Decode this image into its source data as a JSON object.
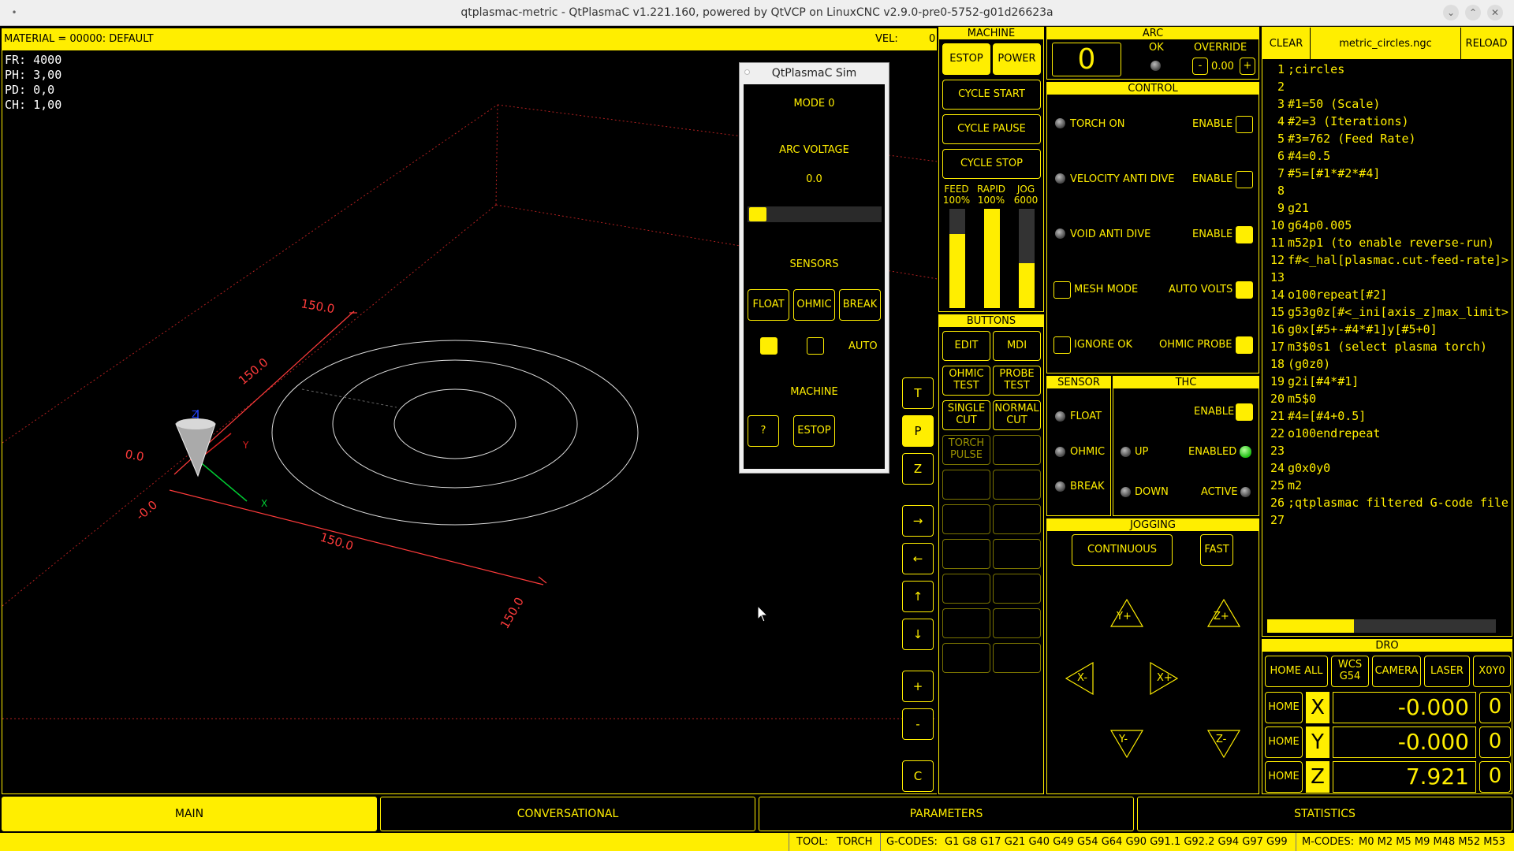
{
  "window": {
    "title": "qtplasmac-metric - QtPlasmaC v1.221.160, powered by QtVCP on LinuxCNC v2.9.0-pre0-5752-g01d26623a"
  },
  "preview": {
    "material": "MATERIAL = 00000: DEFAULT",
    "vel_label": "VEL:",
    "vel_value": "0",
    "stats": [
      "FR: 4000",
      "PH: 3,00",
      "PD: 0,0",
      "CH: 1,00"
    ],
    "dims": {
      "a": "150.0",
      "b": "150.0",
      "c": "0.0",
      "d": "-0.0",
      "e": "150.0",
      "f": "150.0"
    },
    "axis_labels": {
      "x": "X",
      "y": "Y",
      "z": "Z"
    }
  },
  "side_buttons": [
    "T",
    "P",
    "Z",
    "→",
    "←",
    "↑",
    "↓",
    "+",
    "-",
    "C"
  ],
  "sim": {
    "title": "QtPlasmaC Sim",
    "mode": "MODE 0",
    "arc_voltage_label": "ARC VOLTAGE",
    "arc_voltage_value": "0.0",
    "sensors_label": "SENSORS",
    "float": "FLOAT",
    "ohmic": "OHMIC",
    "break": "BREAK",
    "auto": "AUTO",
    "machine_label": "MACHINE",
    "help": "?",
    "estop": "ESTOP"
  },
  "machine": {
    "header": "MACHINE",
    "estop": "ESTOP",
    "power": "POWER",
    "cycle_start": "CYCLE START",
    "cycle_pause": "CYCLE PAUSE",
    "cycle_stop": "CYCLE STOP",
    "feed_label": "FEED",
    "feed_value": "100%",
    "rapid_label": "RAPID",
    "rapid_value": "100%",
    "jog_label": "JOG",
    "jog_value": "6000",
    "feed_level": 0.75,
    "rapid_level": 1.0,
    "jog_level": 0.45
  },
  "buttons": {
    "header": "BUTTONS",
    "edit": "EDIT",
    "mdi": "MDI",
    "ohmic_test": "OHMIC\nTEST",
    "probe_test": "PROBE\nTEST",
    "single_cut": "SINGLE\nCUT",
    "normal_cut": "NORMAL\nCUT",
    "torch_pulse": "TORCH\nPULSE"
  },
  "arc": {
    "header": "ARC",
    "value": "0",
    "ok": "OK",
    "override": "OVERRIDE",
    "minus": "-",
    "override_value": "0.00",
    "plus": "+"
  },
  "control": {
    "header": "CONTROL",
    "torch_on": "TORCH ON",
    "velocity_anti_dive": "VELOCITY ANTI DIVE",
    "void_anti_dive": "VOID ANTI DIVE",
    "enable": "ENABLE",
    "mesh_mode": "MESH MODE",
    "auto_volts": "AUTO VOLTS",
    "ignore_ok": "IGNORE OK",
    "ohmic_probe": "OHMIC PROBE"
  },
  "sensor": {
    "header": "SENSOR",
    "float": "FLOAT",
    "ohmic": "OHMIC",
    "break": "BREAK"
  },
  "thc": {
    "header": "THC",
    "enable": "ENABLE",
    "up": "UP",
    "enabled": "ENABLED",
    "down": "DOWN",
    "active": "ACTIVE"
  },
  "jogging": {
    "header": "JOGGING",
    "continuous": "CONTINUOUS",
    "fast": "FAST",
    "y_plus": "Y+",
    "z_plus": "Z+",
    "x_minus": "X-",
    "x_plus": "X+",
    "y_minus": "Y-",
    "z_minus": "Z-"
  },
  "gcode": {
    "clear": "CLEAR",
    "filename": "metric_circles.ngc",
    "reload": "RELOAD",
    "lines": [
      {
        "n": "1",
        "text": ";circles"
      },
      {
        "n": "2",
        "text": ""
      },
      {
        "n": "3",
        "text": "#1=50 (Scale)"
      },
      {
        "n": "4",
        "text": "#2=3 (Iterations)"
      },
      {
        "n": "5",
        "text": "#3=762 (Feed Rate)"
      },
      {
        "n": "6",
        "text": "#4=0.5"
      },
      {
        "n": "7",
        "text": "#5=[#1*#2*#4]"
      },
      {
        "n": "8",
        "text": ""
      },
      {
        "n": "9",
        "text": "g21"
      },
      {
        "n": "10",
        "text": "g64p0.005"
      },
      {
        "n": "11",
        "text": "m52p1 (to enable reverse-run)"
      },
      {
        "n": "12",
        "text": "f#<_hal[plasmac.cut-feed-rate]>"
      },
      {
        "n": "13",
        "text": ""
      },
      {
        "n": "14",
        "text": "o100repeat[#2]"
      },
      {
        "n": "15",
        "text": "g53g0z[#<_ini[axis_z]max_limit>"
      },
      {
        "n": "16",
        "text": "g0x[#5+-#4*#1]y[#5+0]"
      },
      {
        "n": "17",
        "text": "m3$0s1 (select plasma torch)"
      },
      {
        "n": "18",
        "text": "(g0z0)"
      },
      {
        "n": "19",
        "text": "g2i[#4*#1]"
      },
      {
        "n": "20",
        "text": "m5$0"
      },
      {
        "n": "21",
        "text": "#4=[#4+0.5]"
      },
      {
        "n": "22",
        "text": "o100endrepeat"
      },
      {
        "n": "23",
        "text": ""
      },
      {
        "n": "24",
        "text": "g0x0y0"
      },
      {
        "n": "25",
        "text": "m2"
      },
      {
        "n": "26",
        "text": ";qtplasmac filtered G-code file"
      },
      {
        "n": "27",
        "text": ""
      }
    ],
    "progress": 0.38
  },
  "dro": {
    "header": "DRO",
    "home_all": "HOME ALL",
    "wcs": "WCS\nG54",
    "camera": "CAMERA",
    "laser": "LASER",
    "x0y0": "X0Y0",
    "home": "HOME",
    "axes": [
      {
        "axis": "X",
        "value": "-0.000",
        "zero": "0"
      },
      {
        "axis": "Y",
        "value": "-0.000",
        "zero": "0"
      },
      {
        "axis": "Z",
        "value": "7.921",
        "zero": "0"
      }
    ]
  },
  "tabs": [
    "MAIN",
    "CONVERSATIONAL",
    "PARAMETERS",
    "STATISTICS"
  ],
  "status": {
    "tool_label": "TOOL:",
    "tool": "TORCH",
    "gcodes_label": "G-CODES:",
    "gcodes": "G1 G8 G17 G21 G40 G49 G54 G64 G90 G91.1 G92.2 G94 G97 G99",
    "mcodes_label": "M-CODES:",
    "mcodes": "M0 M2 M5 M9 M48 M52 M53"
  }
}
